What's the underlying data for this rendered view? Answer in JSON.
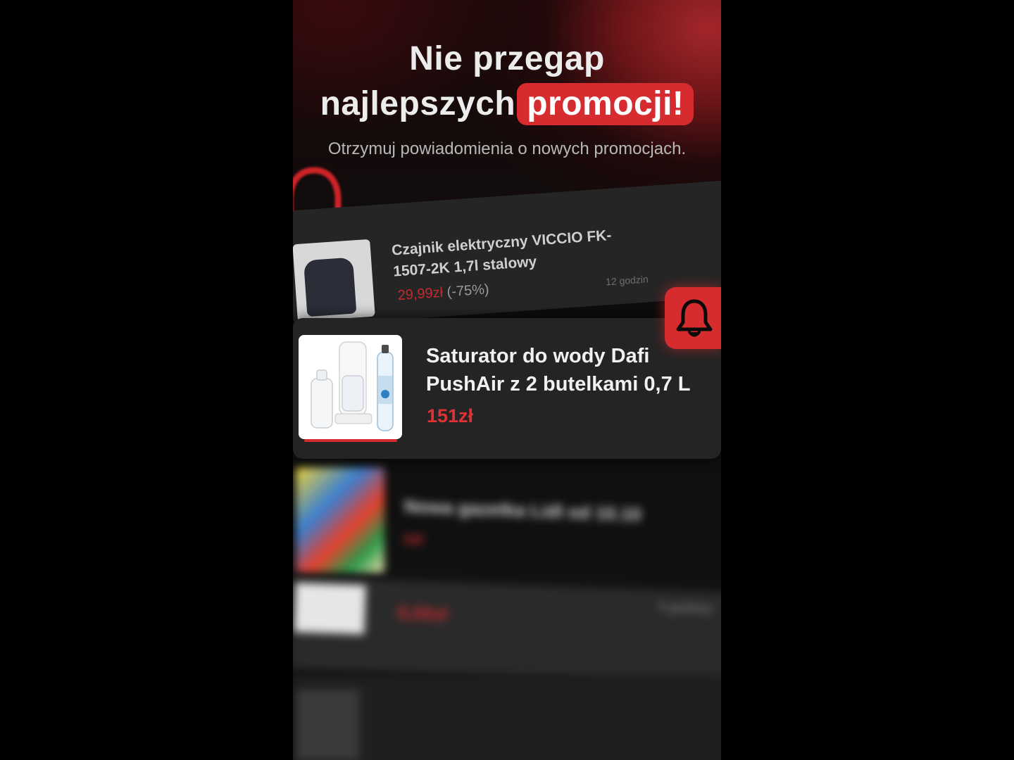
{
  "headline": {
    "line1": "Nie przegap",
    "line2_prefix": "najlepszych",
    "line2_highlight": "promocji!"
  },
  "subtitle": "Otrzymuj powiadomienia o nowych promocjach.",
  "cards": {
    "back": {
      "title": "Czajnik elektryczny VICCIO FK-1507-2K 1,7l stalowy",
      "price": "29,99zł",
      "discount": "(-75%)",
      "time": "12 godzin"
    },
    "front": {
      "title": "Saturator do wody Dafi PushAir z 2 butelkami 0,7 L",
      "price": "151zł"
    },
    "blurred1": {
      "title": "Nowa gazetka Lidl od 10.10",
      "price": "0zł"
    },
    "blurred2": {
      "time": "4 godziny",
      "price": "0,00zł"
    }
  },
  "icons": {
    "bell_button": "bell-icon",
    "bell_outline": "bell-outline-icon"
  },
  "colors": {
    "accent": "#d72c2f",
    "card_bg": "#242424",
    "price": "#e03236"
  }
}
